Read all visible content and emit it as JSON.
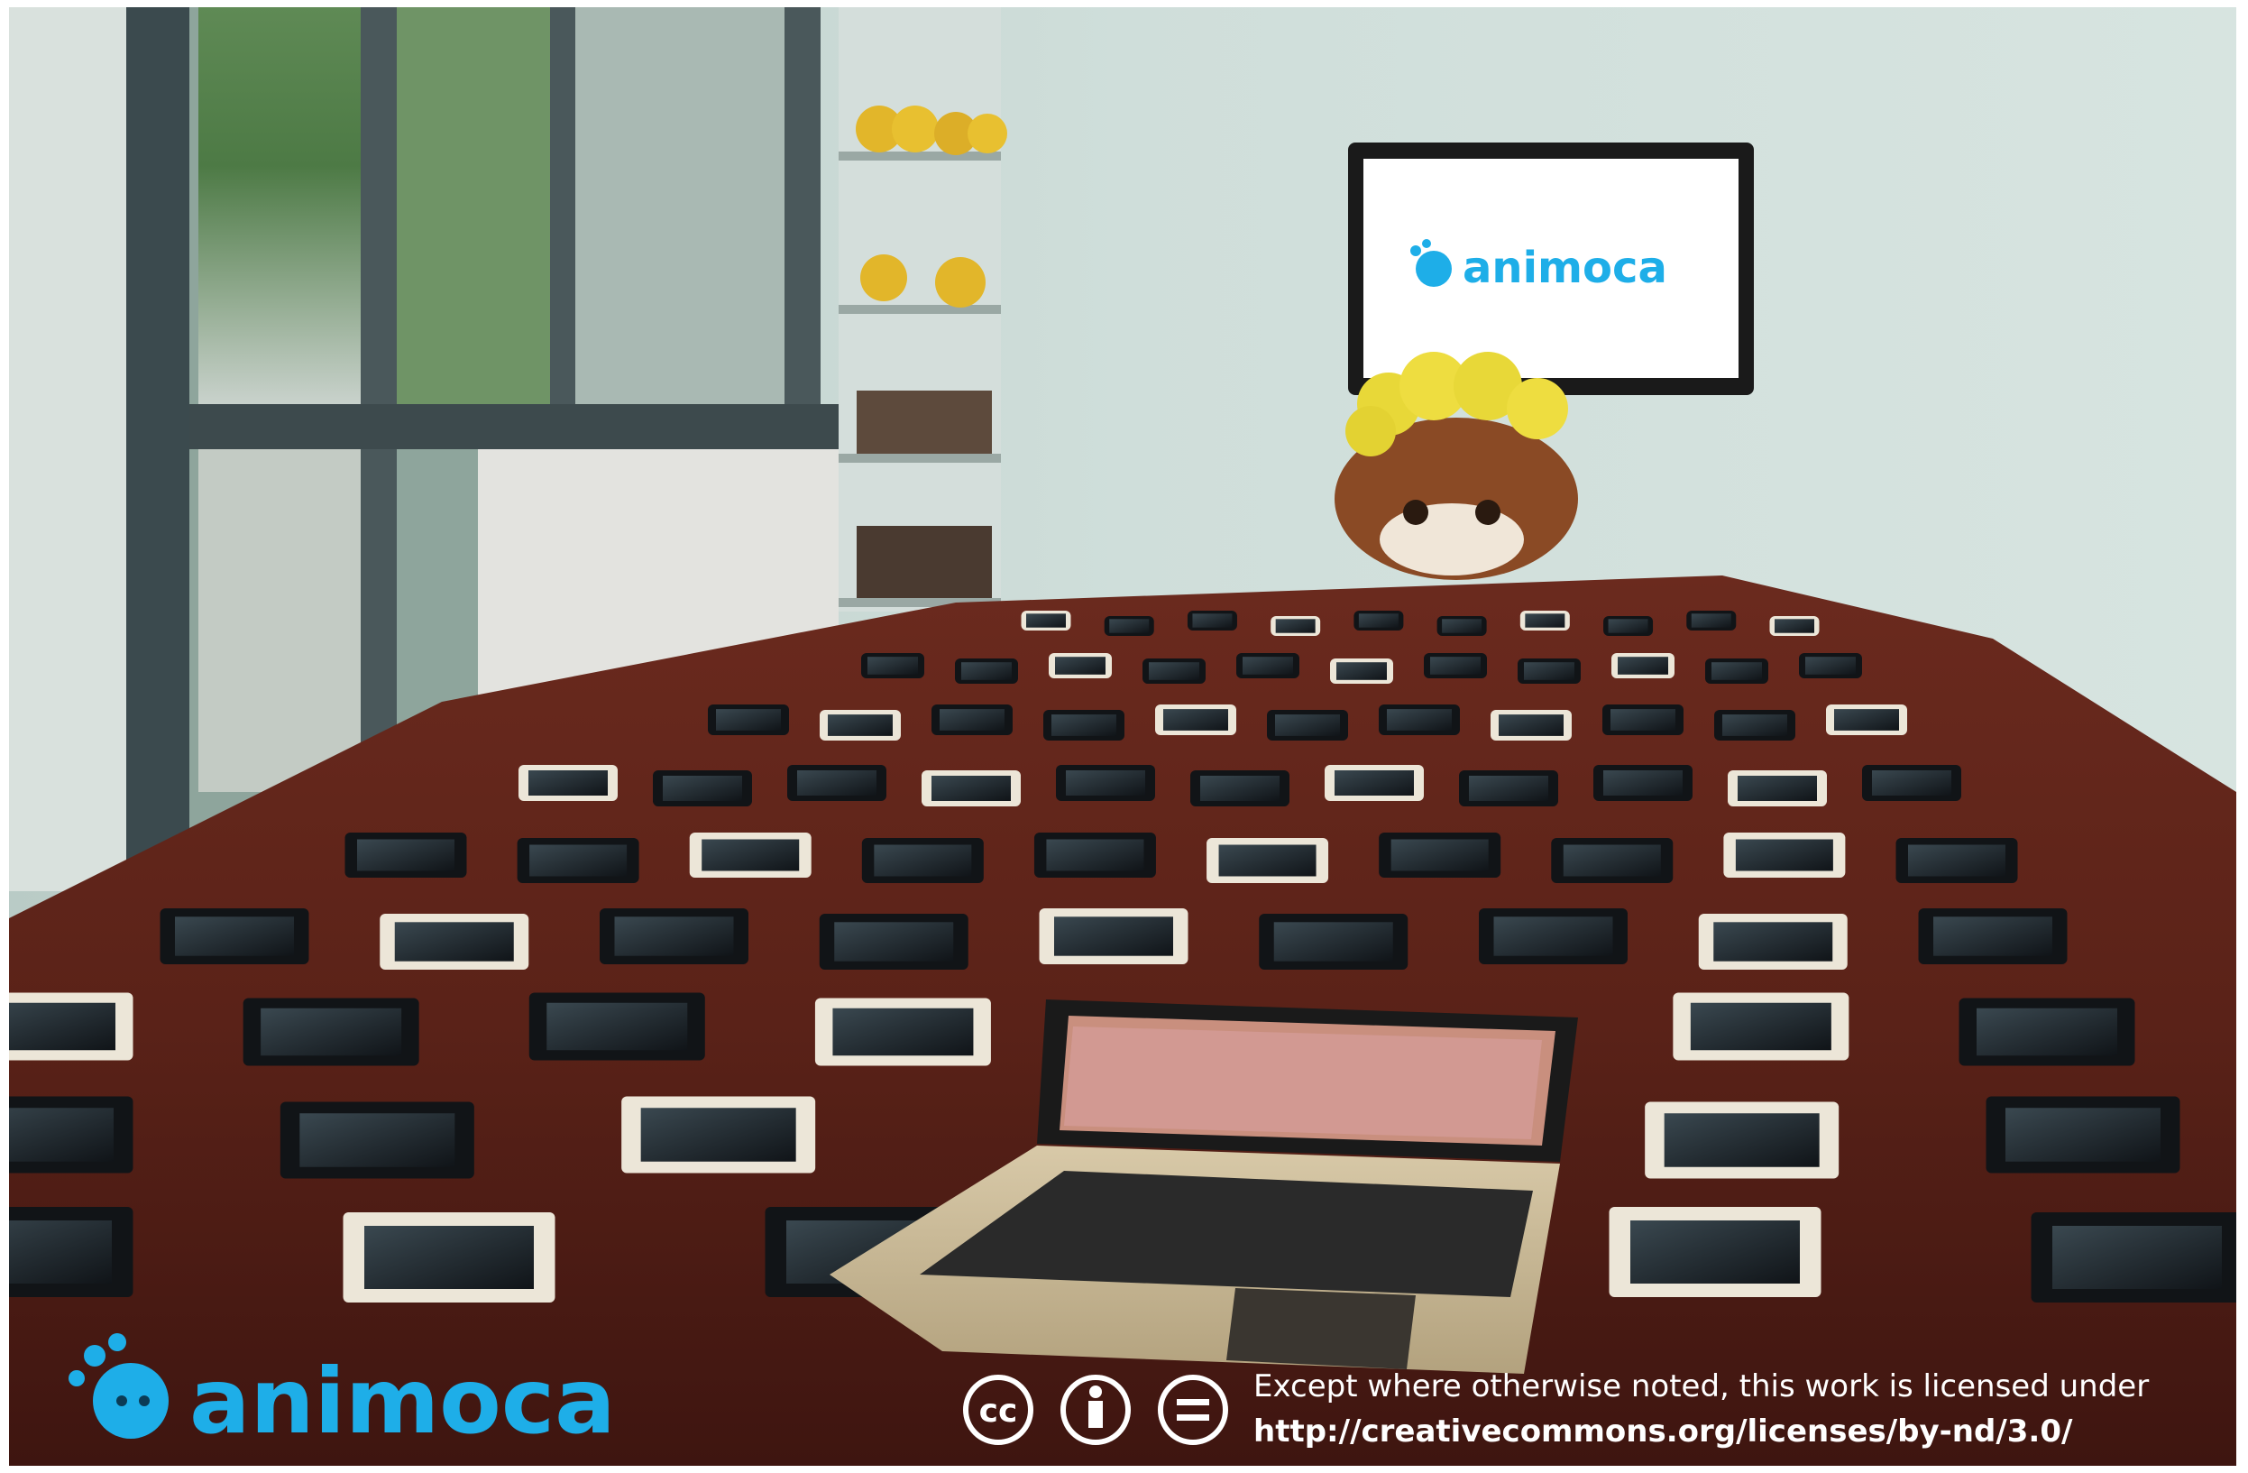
{
  "photo": {
    "subject": "",
    "tv_screen": {
      "logo_text": "animoca"
    },
    "watermark": {
      "logo_text": "animoca",
      "license_line1": "Except where otherwise noted, this work is licensed under",
      "license_line2": "http://creativecommons.org/licenses/by-nd/3.0/",
      "cc_icons": [
        "cc-icon",
        "by-attribution-icon",
        "no-derivatives-icon"
      ]
    }
  },
  "colors": {
    "brand_blue": "#1eaee8",
    "table_wood": "#5a2218",
    "wall": "#c9d9d4"
  }
}
